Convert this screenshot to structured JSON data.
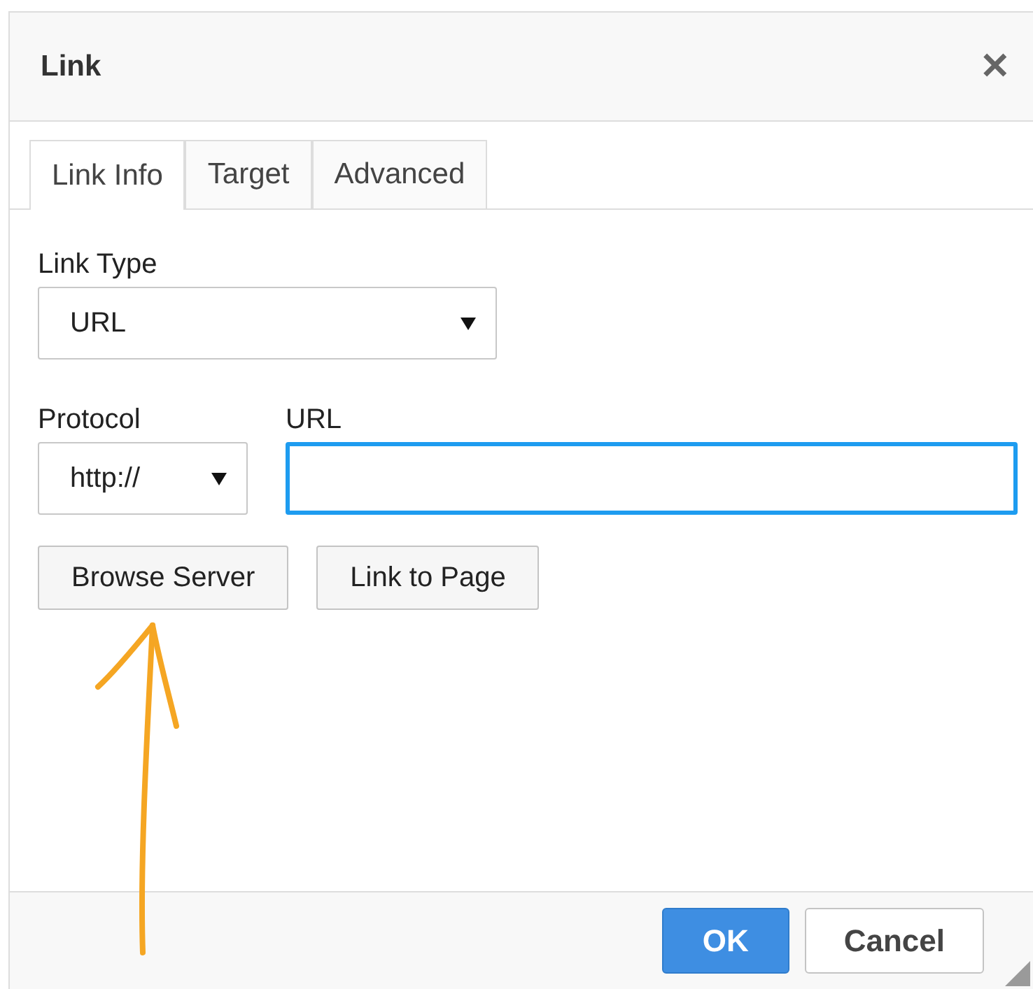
{
  "dialog": {
    "title": "Link",
    "close": "✕"
  },
  "tabs": [
    {
      "label": "Link Info",
      "selected": true
    },
    {
      "label": "Target",
      "selected": false
    },
    {
      "label": "Advanced",
      "selected": false
    }
  ],
  "link_type": {
    "label": "Link Type",
    "value": "URL"
  },
  "protocol": {
    "label": "Protocol",
    "value": "http://"
  },
  "url": {
    "label": "URL",
    "focused": true
  },
  "buttons": [
    "Browse Server",
    "Link to Page"
  ],
  "footer": [
    {
      "label": "OK",
      "kind": "primary"
    },
    {
      "label": "Cancel",
      "kind": "secondary"
    }
  ]
}
